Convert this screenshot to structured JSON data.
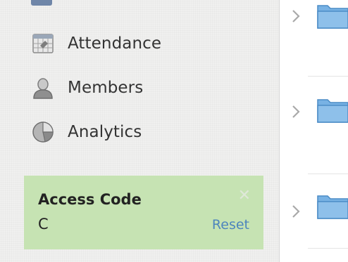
{
  "sidebar": {
    "items": [
      {
        "label": "Attendance",
        "icon": "calendar-icon"
      },
      {
        "label": "Members",
        "icon": "person-icon"
      },
      {
        "label": "Analytics",
        "icon": "pie-chart-icon"
      }
    ],
    "cut_off_item_icon": "folder-icon"
  },
  "access_code": {
    "title": "Access Code",
    "value": "C",
    "reset_label": "Reset",
    "close_icon": "close-icon"
  },
  "colors": {
    "sidebar_bg": "#f0f0ef",
    "access_bg": "#c6e3b3",
    "reset_link": "#4d85bd",
    "folder_blue": "#5b9dd8"
  },
  "rows": [
    {
      "icon": "folder-icon",
      "chevron": "chevron-right-icon"
    },
    {
      "icon": "folder-icon",
      "chevron": "chevron-right-icon"
    },
    {
      "icon": "folder-icon",
      "chevron": "chevron-right-icon"
    }
  ]
}
